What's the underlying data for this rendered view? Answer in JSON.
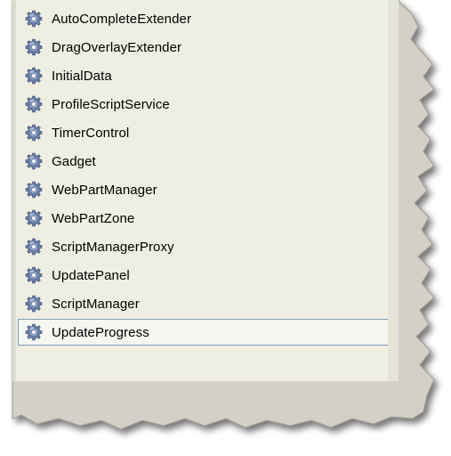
{
  "toolbox": {
    "items": [
      {
        "label": "AutoCompleteExtender",
        "icon": "gear-icon"
      },
      {
        "label": "DragOverlayExtender",
        "icon": "gear-icon"
      },
      {
        "label": "InitialData",
        "icon": "gear-icon"
      },
      {
        "label": "ProfileScriptService",
        "icon": "gear-icon"
      },
      {
        "label": "TimerControl",
        "icon": "gear-icon"
      },
      {
        "label": "Gadget",
        "icon": "gear-icon"
      },
      {
        "label": "WebPartManager",
        "icon": "gear-icon"
      },
      {
        "label": "WebPartZone",
        "icon": "gear-icon"
      },
      {
        "label": "ScriptManagerProxy",
        "icon": "gear-icon"
      },
      {
        "label": "UpdatePanel",
        "icon": "gear-icon"
      },
      {
        "label": "ScriptManager",
        "icon": "gear-icon"
      },
      {
        "label": "UpdateProgress",
        "icon": "gear-icon"
      }
    ],
    "selected": "UpdateProgress"
  },
  "colors": {
    "list_background": "#eeeee2",
    "selection_border": "#7f9db9",
    "panel_gray": "#d4d0c8"
  }
}
